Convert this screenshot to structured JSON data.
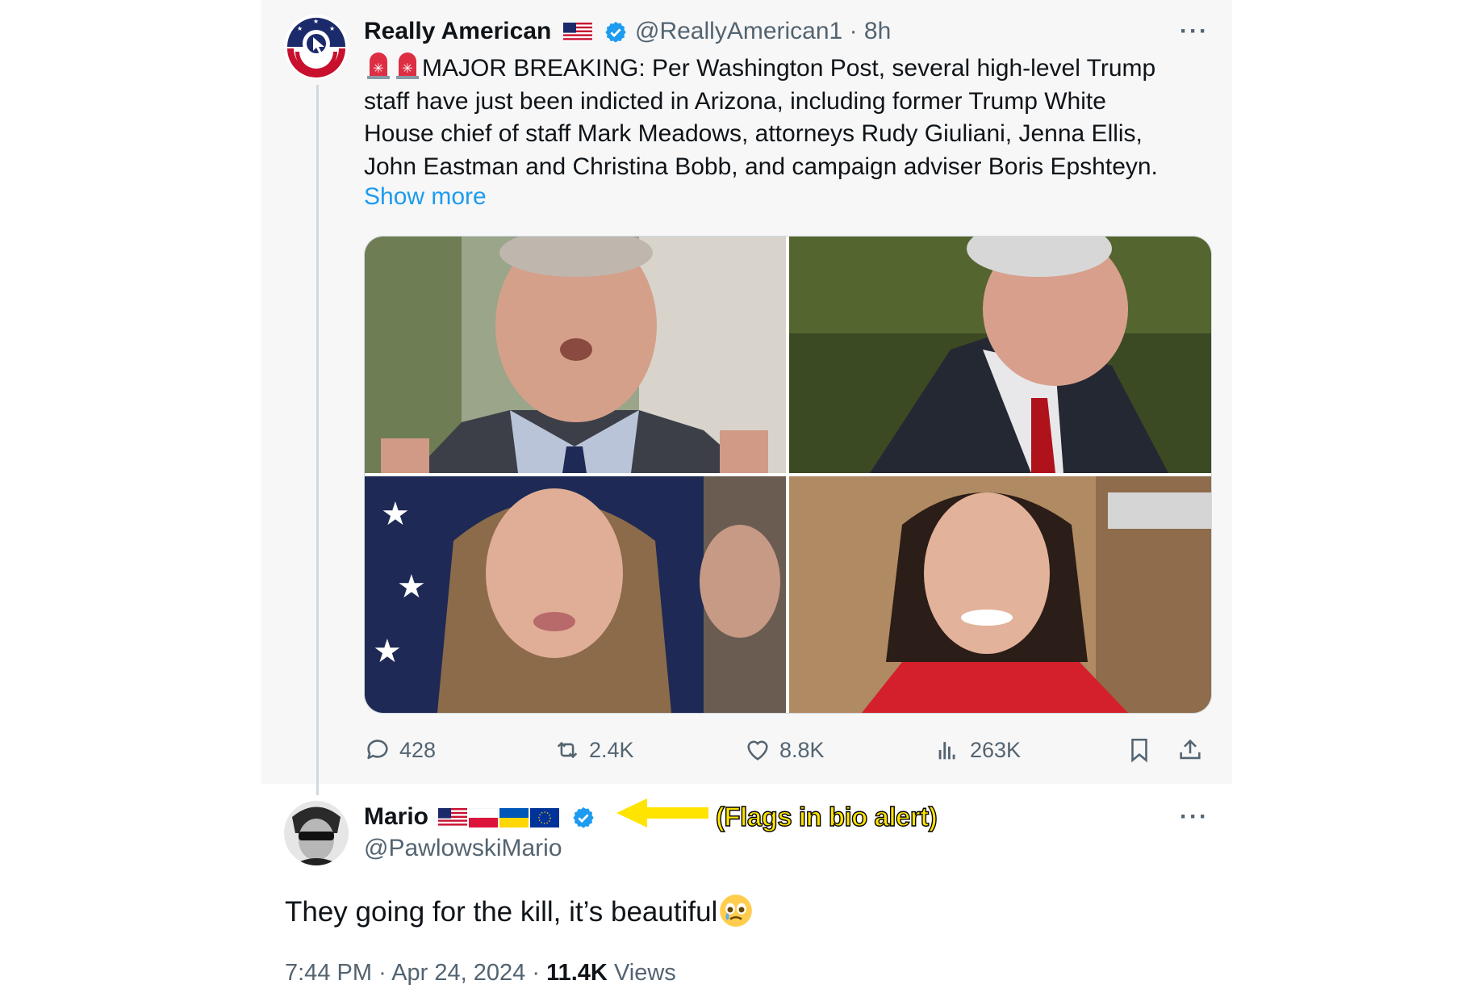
{
  "main_tweet": {
    "author_name": "Really American",
    "handle": "@ReallyAmerican1",
    "time_sep": "·",
    "time": "8h",
    "more": "···",
    "text_lines": [
      "MAJOR BREAKING: Per Washington Post, several high-level Trump",
      "staff have just been indicted in Arizona, including former Trump White",
      "House chief of staff Mark Meadows, attorneys Rudy Giuliani, Jenna Ellis,",
      "John Eastman and Christina Bobb, and campaign adviser Boris Epshteyn."
    ],
    "show_more": "Show more",
    "stats": {
      "replies": "428",
      "reposts": "2.4K",
      "likes": "8.8K",
      "views": "263K"
    }
  },
  "reply": {
    "author_name": "Mario",
    "handle": "@PawlowskiMario",
    "more": "···",
    "text": "They going for the kill, it’s beautiful",
    "time": "7:44 PM",
    "sep1": "·",
    "date": "Apr 24, 2024",
    "sep2": "·",
    "views_count": "11.4K",
    "views_label": "Views"
  },
  "annotation": "(Flags in bio alert)",
  "icons": [
    "siren-emoji",
    "us-flag",
    "verified-badge",
    "reply-icon",
    "repost-icon",
    "like-icon",
    "views-icon",
    "bookmark-icon",
    "share-icon",
    "poland-flag",
    "ukraine-flag",
    "eu-flag",
    "teary-face-emoji",
    "arrow"
  ],
  "colors": {
    "link": "#1d9bf0",
    "verified": "#1d9bf0",
    "secondary_text": "#536471",
    "annotation": "#ffe400"
  }
}
